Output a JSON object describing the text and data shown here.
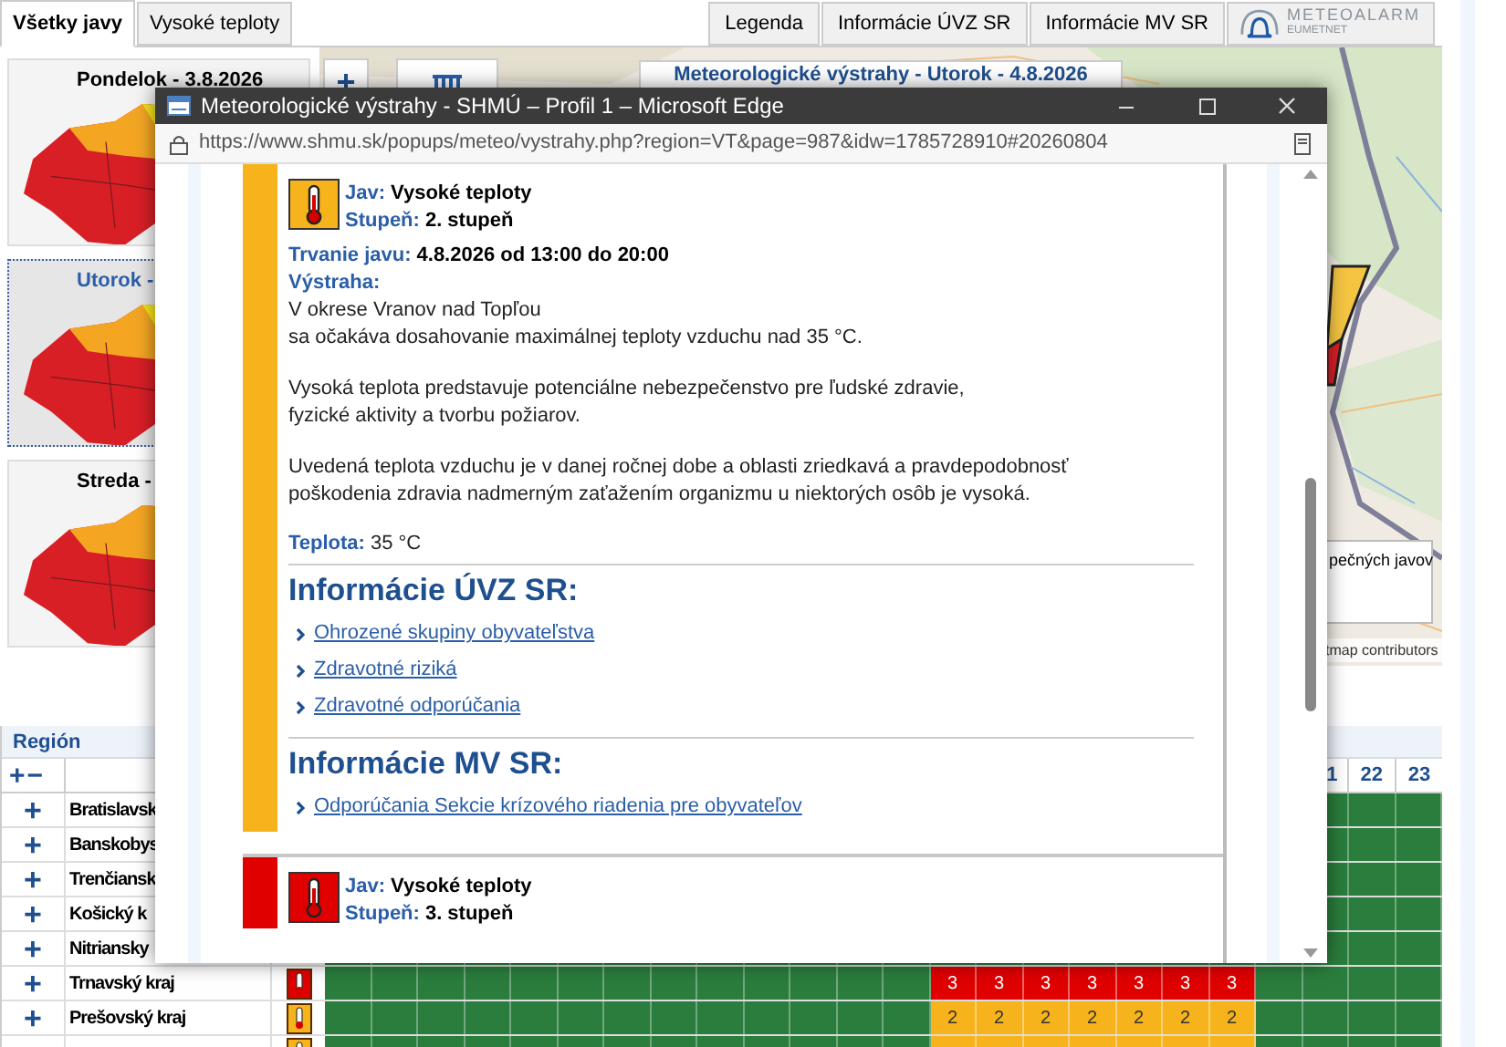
{
  "tabs": [
    {
      "label": "Všetky javy",
      "selected": true
    },
    {
      "label": "Vysoké teploty",
      "selected": false
    }
  ],
  "info_tabs": [
    {
      "label": "Legenda"
    },
    {
      "label": "Informácie ÚVZ SR"
    },
    {
      "label": "Informácie MV SR"
    }
  ],
  "meteoalarm": {
    "name": "METEOALARM",
    "sub": "EUMETNET"
  },
  "days": [
    {
      "label": "Pondelok - 3.8.2026",
      "selected": false
    },
    {
      "label": "Utorok -",
      "selected": true
    },
    {
      "label": "Streda -",
      "selected": false
    }
  ],
  "map": {
    "zoom_in": "+",
    "title": "Meteorologické výstrahy - Utorok - 4.8.2026",
    "legend_text": "pečných javov",
    "attribution": "tmap contributors"
  },
  "table": {
    "region_header": "Región",
    "expand_all": "+",
    "collapse_all": "−",
    "hour_headers": [
      "1",
      "22",
      "23"
    ],
    "rows": [
      {
        "toggle": "+",
        "name": "Bratislavsk"
      },
      {
        "toggle": "+",
        "name": "Banskobys"
      },
      {
        "toggle": "+",
        "name": "Trenčiansk"
      },
      {
        "toggle": "+",
        "name": "Košický k"
      },
      {
        "toggle": "+",
        "name": "Nitriansky"
      },
      {
        "toggle": "+",
        "name": "Trnavský kraj",
        "color": "#e00000",
        "cells": [
          null,
          null,
          null,
          null,
          null,
          null,
          null,
          null,
          null,
          null,
          null,
          null,
          null,
          {
            "text": "3",
            "color": "#e00000"
          },
          {
            "text": "3",
            "color": "#e00000"
          },
          {
            "text": "3",
            "color": "#e00000"
          },
          {
            "text": "3",
            "color": "#e00000"
          },
          {
            "text": "3",
            "color": "#e00000"
          },
          {
            "text": "3",
            "color": "#e00000"
          },
          {
            "text": "3",
            "color": "#e00000"
          },
          null,
          null,
          null,
          null
        ]
      },
      {
        "toggle": "+",
        "name": "Prešovský kraj",
        "color": "#f7b31c",
        "cells": [
          null,
          null,
          null,
          null,
          null,
          null,
          null,
          null,
          null,
          null,
          null,
          null,
          null,
          {
            "text": "2",
            "color": "#f7b31c"
          },
          {
            "text": "2",
            "color": "#f7b31c"
          },
          {
            "text": "2",
            "color": "#f7b31c"
          },
          {
            "text": "2",
            "color": "#f7b31c"
          },
          {
            "text": "2",
            "color": "#f7b31c"
          },
          {
            "text": "2",
            "color": "#f7b31c"
          },
          {
            "text": "2",
            "color": "#f7b31c"
          },
          null,
          null,
          null,
          null
        ]
      },
      {
        "color": "#f7b31c",
        "cells": [
          null,
          null,
          null,
          null,
          null,
          null,
          null,
          null,
          null,
          null,
          null,
          null,
          null,
          {
            "color": "#f7b31c"
          },
          {
            "color": "#f7b31c"
          },
          {
            "color": "#f7b31c"
          },
          {
            "color": "#f7b31c"
          },
          {
            "color": "#f7b31c"
          },
          {
            "color": "#f7b31c"
          },
          {
            "color": "#f7b31c"
          },
          null,
          null,
          null,
          null
        ]
      }
    ]
  },
  "popup": {
    "title": "Meteorologické výstrahy - SHMÚ – Profil 1 – Microsoft Edge",
    "url": "https://www.shmu.sk/popups/meteo/vystrahy.php?region=VT&page=987&idw=1785728910#20260804",
    "warnings": [
      {
        "color": "#f7b31c",
        "fields": [
          {
            "label": "Jav:",
            "value": "Vysoké teploty"
          },
          {
            "label": "Stupeň:",
            "value": "2. stupeň"
          },
          {
            "label": "Trvanie javu:",
            "value": "4.8.2026 od 13:00 do 20:00"
          }
        ],
        "alert_label": "Výstraha:",
        "paragraphs": [
          "V okrese Vranov nad Topľou\nsa očakáva dosahovanie maximálnej teploty vzduchu nad 35 °C.",
          "Vysoká teplota predstavuje potenciálne nebezpečenstvo pre ľudské zdravie,\nfyzické aktivity a tvorbu požiarov.",
          "Uvedená teplota vzduchu je v danej ročnej dobe a oblasti zriedkavá a pravdepodobnosť\npoškodenia zdravia nadmerným zaťažením organizmu u niektorých osôb je vysoká."
        ],
        "temperature": {
          "label": "Teplota:",
          "value": "35 °C"
        },
        "sections": [
          {
            "heading": "Informácie ÚVZ SR:",
            "links": [
              "Ohrozené skupiny obyvateľstva",
              "Zdravotné riziká",
              "Zdravotné odporúčania"
            ]
          },
          {
            "heading": "Informácie MV SR:",
            "links": [
              "Odporúčania Sekcie krízového riadenia pre obyvateľov"
            ]
          }
        ]
      },
      {
        "color": "#e00000",
        "fields": [
          {
            "label": "Jav:",
            "value": "Vysoké teploty"
          },
          {
            "label": "Stupeň:",
            "value": "3. stupeň"
          }
        ]
      }
    ]
  }
}
